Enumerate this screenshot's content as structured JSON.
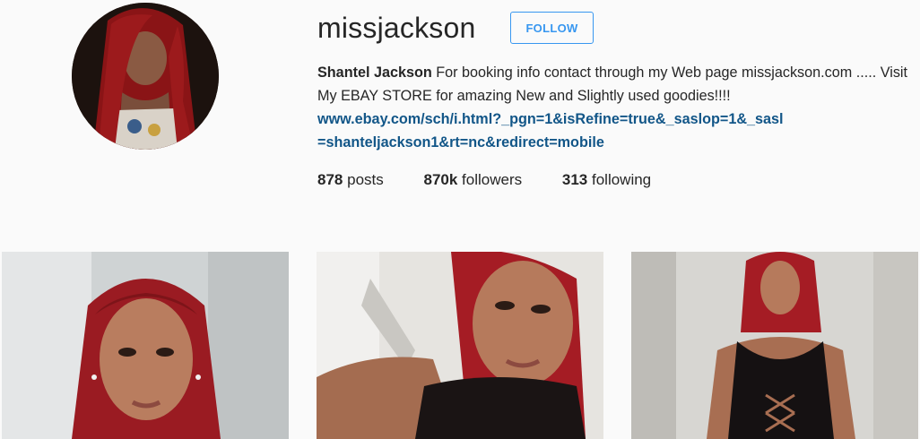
{
  "profile": {
    "username": "missjackson",
    "follow_label": "FOLLOW",
    "full_name": "Shantel Jackson",
    "bio_text": " For booking info contact through my Web page missjackson.com ..... Visit My EBAY STORE for amazing New and Slightly used goodies!!!!",
    "bio_link": "www.ebay.com/sch/i.html?_pgn=1&isRefine=true&_saslop=1&_sasl=shanteljackson1&rt=nc&redirect=mobile",
    "accent_color": "#3897f0",
    "link_color": "#125688"
  },
  "stats": {
    "posts_count": "878",
    "posts_label": "posts",
    "followers_count": "870k",
    "followers_label": "followers",
    "following_count": "313",
    "following_label": "following"
  }
}
